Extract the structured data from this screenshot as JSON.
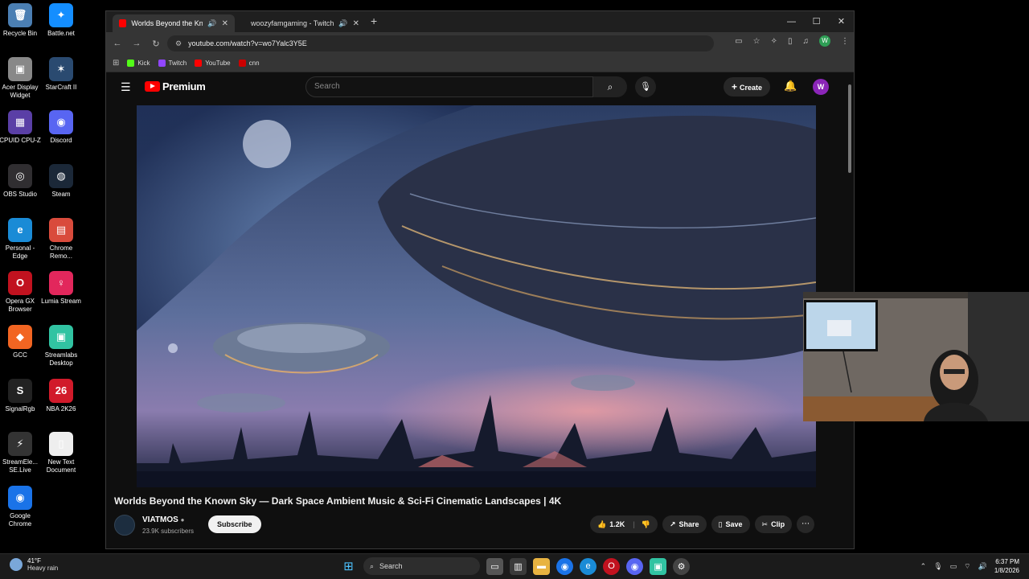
{
  "desktop": {
    "icons": [
      {
        "label": "Recycle Bin",
        "glyph": "🗑",
        "color": "#4b7fb3"
      },
      {
        "label": "Battle.net",
        "glyph": "✦",
        "color": "#148eff"
      },
      {
        "label": "Acer Display Widget",
        "glyph": "▣",
        "color": "#888888"
      },
      {
        "label": "StarCraft II",
        "glyph": "✶",
        "color": "#2a4a70"
      },
      {
        "label": "CPUID CPU-Z",
        "glyph": "▦",
        "color": "#5a3fa6"
      },
      {
        "label": "Discord",
        "glyph": "◉",
        "color": "#5865f2"
      },
      {
        "label": "OBS Studio",
        "glyph": "◎",
        "color": "#302e31"
      },
      {
        "label": "Steam",
        "glyph": "◍",
        "color": "#1b2838"
      },
      {
        "label": "Personal - Edge",
        "glyph": "e",
        "color": "#1a8bd6"
      },
      {
        "label": "Chrome Remo...",
        "glyph": "▤",
        "color": "#d94b3c"
      },
      {
        "label": "Opera GX Browser",
        "glyph": "O",
        "color": "#c1121f"
      },
      {
        "label": "Lumia Stream",
        "glyph": "♀",
        "color": "#e2275c"
      },
      {
        "label": "GCC",
        "glyph": "◆",
        "color": "#f26522"
      },
      {
        "label": "Streamlabs Desktop",
        "glyph": "▣",
        "color": "#31c3a2"
      },
      {
        "label": "SignalRgb",
        "glyph": "S",
        "color": "#222222"
      },
      {
        "label": "NBA 2K26",
        "glyph": "26",
        "color": "#d11a2a"
      },
      {
        "label": "StreamEle... SE.Live",
        "glyph": "⚡",
        "color": "#333333"
      },
      {
        "label": "New Text Document",
        "glyph": "▯",
        "color": "#eeeeee"
      },
      {
        "label": "Google Chrome",
        "glyph": "◉",
        "color": "#1a73e8"
      }
    ]
  },
  "browser": {
    "tabs": [
      {
        "title": "Worlds Beyond the Known",
        "favcolor": "#ff0000"
      },
      {
        "title": "woozyfamgaming - Twitch",
        "favcolor": "#9146ff"
      }
    ],
    "url": "youtube.com/watch?v=wo7Yalc3Y5E",
    "bookmarks": [
      {
        "label": "Kick",
        "color": "#53fc18"
      },
      {
        "label": "Twitch",
        "color": "#9146ff"
      },
      {
        "label": "YouTube",
        "color": "#ff0000"
      },
      {
        "label": "cnn",
        "color": "#cc0000"
      }
    ],
    "profile_initial": "W"
  },
  "youtube": {
    "logo_text": "Premium",
    "search_placeholder": "Search",
    "create_label": "Create",
    "avatar_initial": "W",
    "video_title": "Worlds Beyond the Known Sky — Dark Space Ambient Music & Sci-Fi Cinematic Landscapes | 4K",
    "channel_name": "VIATMOS",
    "subscribers": "23.9K subscribers",
    "subscribe_label": "Subscribe",
    "likes": "1.2K",
    "share_label": "Share",
    "save_label": "Save",
    "clip_label": "Clip"
  },
  "taskbar": {
    "temperature": "41°F",
    "weather": "Heavy rain",
    "search_label": "Search",
    "time": "6:37 PM",
    "date": "1/8/2026"
  }
}
